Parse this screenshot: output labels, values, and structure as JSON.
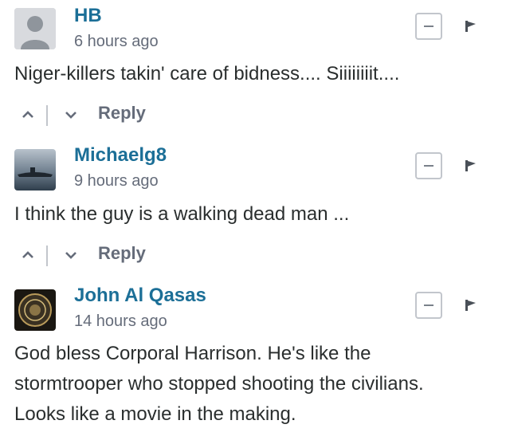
{
  "comments": [
    {
      "author": "HB",
      "time": "6 hours ago",
      "lines": [
        "Niger-killers takin' care of bidness.... Siiiiiiiit...."
      ],
      "reply_label": "Reply",
      "avatar": "default-avatar"
    },
    {
      "author": "Michaelg8",
      "time": "9 hours ago",
      "lines": [
        "I think the guy is a walking dead man ..."
      ],
      "reply_label": "Reply",
      "avatar": "submarine-photo"
    },
    {
      "author": "John Al Qasas",
      "time": "14 hours ago",
      "lines": [
        "God bless Corporal Harrison. He's like the",
        "stormtrooper who stopped shooting the civilians.",
        "Looks like a movie in the making."
      ],
      "avatar": "emblem-photo"
    }
  ],
  "colors": {
    "author": "#1c6f97",
    "meta": "#656c7a",
    "text": "#2a2e2e",
    "border": "#c2c6cc"
  },
  "icons": {
    "collapse": "minus-box-icon",
    "flag": "flag-icon",
    "upvote": "chevron-up-icon",
    "downvote": "chevron-down-icon"
  }
}
